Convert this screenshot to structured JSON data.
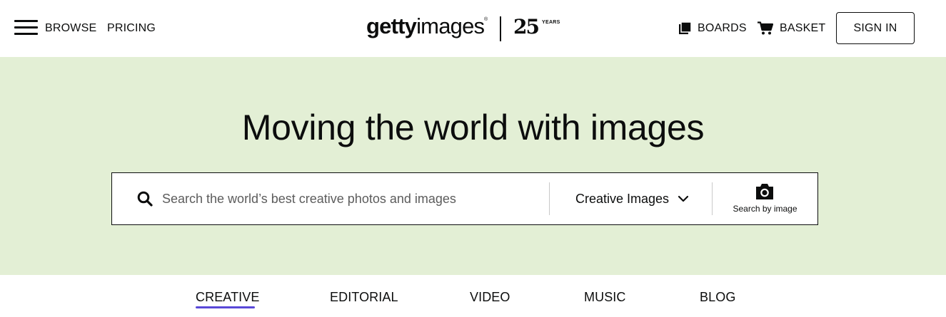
{
  "header": {
    "browse_label": "BROWSE",
    "pricing_label": "PRICING",
    "logo": {
      "getty": "getty",
      "images": "images",
      "registered": "®",
      "anniversary_number": "25",
      "anniversary_word": "YEARS"
    },
    "boards_label": "BOARDS",
    "basket_label": "BASKET",
    "signin_label": "SIGN IN",
    "icons": {
      "menu": "hamburger-menu-icon",
      "boards": "boards-icon",
      "basket": "cart-icon"
    }
  },
  "hero": {
    "title": "Moving the world with images",
    "background_color": "#e3efd5",
    "search": {
      "placeholder": "Search the world’s best creative photos and images",
      "value": "",
      "type_selected": "Creative Images",
      "search_by_image_label": "Search by image",
      "icons": {
        "search": "search-icon",
        "dropdown": "chevron-down-icon",
        "camera": "camera-icon"
      }
    }
  },
  "tabs": {
    "items": [
      {
        "label": "CREATIVE",
        "active": true
      },
      {
        "label": "EDITORIAL",
        "active": false
      },
      {
        "label": "VIDEO",
        "active": false
      },
      {
        "label": "MUSIC",
        "active": false
      },
      {
        "label": "BLOG",
        "active": false
      }
    ],
    "active_underline_color": "#5948d8"
  }
}
